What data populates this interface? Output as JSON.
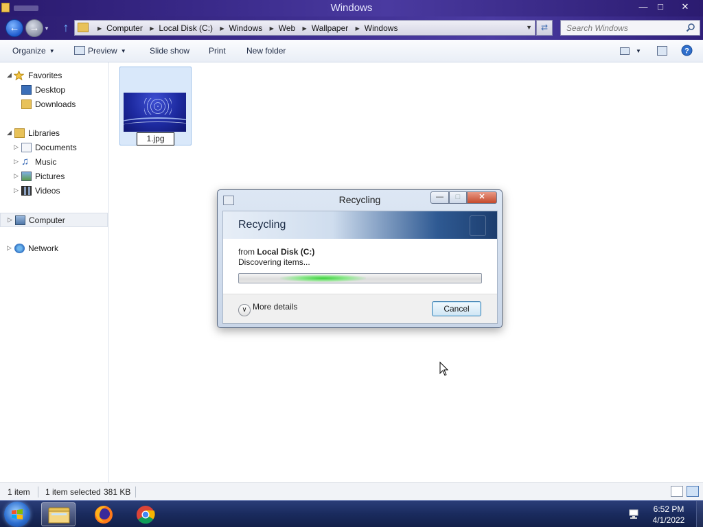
{
  "window": {
    "title": "Windows",
    "controls": {
      "minimize": "—",
      "maximize": "□",
      "close": "✕"
    }
  },
  "address_bar": {
    "crumbs": [
      "Computer",
      "Local Disk (C:)",
      "Windows",
      "Web",
      "Wallpaper",
      "Windows"
    ],
    "separator": "▶",
    "dropdown": "▼"
  },
  "search": {
    "placeholder": "Search Windows"
  },
  "toolbar": {
    "organize": "Organize",
    "preview": "Preview",
    "slideshow": "Slide show",
    "print": "Print",
    "new_folder": "New folder"
  },
  "nav_pane": {
    "favorites": {
      "label": "Favorites",
      "items": [
        "Desktop",
        "Downloads"
      ]
    },
    "libraries": {
      "label": "Libraries",
      "items": [
        "Documents",
        "Music",
        "Pictures",
        "Videos"
      ]
    },
    "computer": "Computer",
    "network": "Network"
  },
  "files": [
    {
      "name": "1.jpg"
    }
  ],
  "dialog": {
    "title": "Recycling",
    "heading": "Recycling",
    "from_prefix": "from",
    "from_location": "Local Disk (C:)",
    "status": "Discovering items...",
    "more_details": "More details",
    "cancel": "Cancel"
  },
  "status_bar": {
    "item_count": "1 item",
    "selected": "1 item selected",
    "size": "381 KB"
  },
  "taskbar": {
    "time": "6:52 PM",
    "date": "4/1/2022",
    "pinned": [
      "file-explorer-icon",
      "firefox-icon",
      "chrome-icon"
    ]
  },
  "colors": {
    "titlebar": "#3a2a8a",
    "progress_green": "#3ed03e",
    "selection": "#d9e8fa"
  }
}
